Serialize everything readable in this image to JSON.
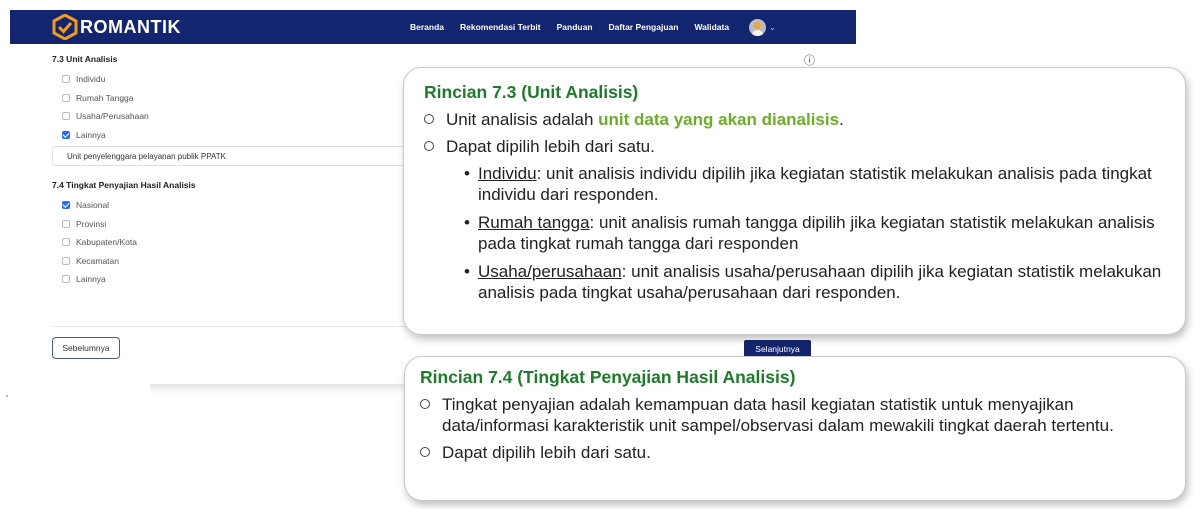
{
  "nav": {
    "brand": "ROMANTIK",
    "links": [
      "Beranda",
      "Rekomendasi Terbit",
      "Panduan",
      "Daftar Pengajuan",
      "Walidata"
    ]
  },
  "form": {
    "section73": {
      "title": "7.3 Unit Analisis",
      "options": [
        {
          "label": "Individu",
          "checked": false
        },
        {
          "label": "Rumah Tangga",
          "checked": false
        },
        {
          "label": "Usaha/Perusahaan",
          "checked": false
        },
        {
          "label": "Lainnya",
          "checked": true
        }
      ],
      "other_value": "Unit penyelenggara pelayanan publik PPATK"
    },
    "section74": {
      "title": "7.4 Tingkat Penyajian Hasil Analisis",
      "options": [
        {
          "label": "Nasional",
          "checked": true
        },
        {
          "label": "Provinsi",
          "checked": false
        },
        {
          "label": "Kabupaten/Kota",
          "checked": false
        },
        {
          "label": "Kecamatan",
          "checked": false
        },
        {
          "label": "Lainnya",
          "checked": false
        }
      ]
    },
    "prev_label": "Sebelumnya",
    "next_label": "Selanjutnya"
  },
  "callout1": {
    "title": "Rincian 7.3 (Unit Analisis)",
    "item1_prefix": "Unit analisis adalah ",
    "item1_highlight": "unit data yang akan dianalisis",
    "item1_suffix": ".",
    "item2": "Dapat dipilih lebih dari satu.",
    "subs": [
      {
        "term": "Individu",
        "text": ": unit analisis individu dipilih jika kegiatan statistik melakukan analisis pada tingkat individu dari responden."
      },
      {
        "term": "Rumah tangga",
        "text": ": unit analisis rumah tangga dipilih jika kegiatan statistik melakukan analisis pada tingkat rumah tangga dari responden"
      },
      {
        "term": "Usaha/perusahaan",
        "text": ": unit analisis usaha/perusahaan dipilih jika kegiatan statistik melakukan analisis pada tingkat usaha/perusahaan dari responden."
      }
    ]
  },
  "callout2": {
    "title": "Rincian 7.4 (Tingkat Penyajian Hasil Analisis)",
    "item1": "Tingkat penyajian adalah kemampuan data hasil kegiatan statistik untuk menyajikan data/informasi karakteristik unit sampel/observasi dalam mewakili tingkat daerah tertentu.",
    "item2": "Dapat dipilih lebih dari satu."
  },
  "colors": {
    "navbar": "#13256e",
    "title_green": "#1f7a2c",
    "highlight_green": "#6cad2a",
    "checkbox_blue": "#2a6df4"
  },
  "icons": [
    "logo-check-icon",
    "help-circle-icon",
    "avatar",
    "chevron-down-icon"
  ]
}
